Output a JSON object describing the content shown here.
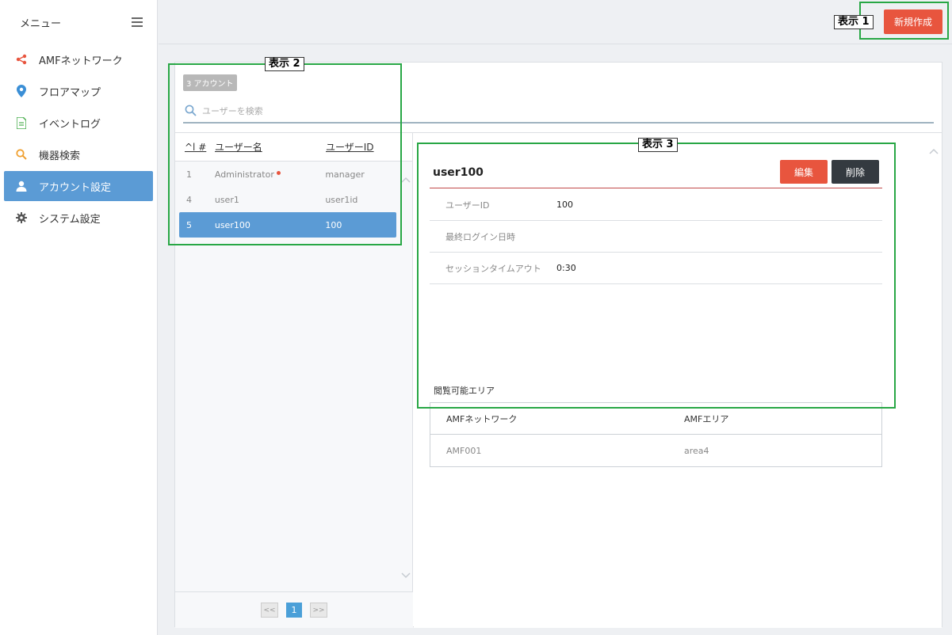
{
  "sidebar": {
    "title": "メニュー",
    "items": [
      {
        "label": "AMFネットワーク",
        "icon": "share-icon",
        "color": "#e8553e"
      },
      {
        "label": "フロアマップ",
        "icon": "map-pin-icon",
        "color": "#3b8fd6"
      },
      {
        "label": "イベントログ",
        "icon": "document-icon",
        "color": "#4caf50"
      },
      {
        "label": "機器検索",
        "icon": "search-icon",
        "color": "#f0a030"
      },
      {
        "label": "アカウント設定",
        "icon": "user-icon",
        "color": "#ffffff",
        "active": true
      },
      {
        "label": "システム設定",
        "icon": "gear-icon",
        "color": "#555555"
      }
    ]
  },
  "topbar": {
    "new_button": "新規作成"
  },
  "annotations": {
    "label1": "表示 1",
    "label2": "表示 2",
    "label3": "表示 3",
    "color": "#28a745"
  },
  "accounts": {
    "count_badge": "3 アカウント",
    "search_placeholder": "ユーザーを検索",
    "columns": {
      "no": "^l #",
      "name": "ユーザー名",
      "id": "ユーザーID"
    },
    "rows": [
      {
        "no": "1",
        "name": "Administrator",
        "id": "manager",
        "flag": true
      },
      {
        "no": "4",
        "name": "user1",
        "id": "user1id"
      },
      {
        "no": "5",
        "name": "user100",
        "id": "100",
        "selected": true
      }
    ],
    "pager": {
      "prev": "<<",
      "current": "1",
      "next": ">>"
    }
  },
  "detail": {
    "title": "user100",
    "edit_button": "編集",
    "delete_button": "削除",
    "fields": [
      {
        "label": "ユーザーID",
        "value": "100"
      },
      {
        "label": "最終ログイン日時",
        "value": ""
      },
      {
        "label": "セッションタイムアウト",
        "value": "0:30"
      }
    ],
    "area_title": "閲覧可能エリア",
    "area_table": {
      "headers": [
        "AMFネットワーク",
        "AMFエリア"
      ],
      "rows": [
        [
          "AMF001",
          "area4"
        ]
      ]
    }
  }
}
